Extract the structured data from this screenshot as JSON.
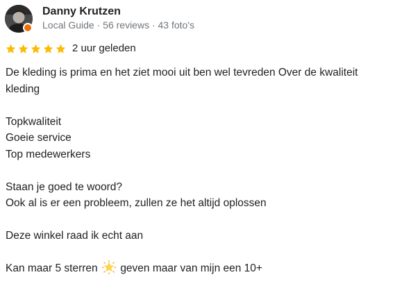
{
  "reviewer": {
    "name": "Danny Krutzen",
    "meta": "Local Guide · 56 reviews · 43 foto's",
    "avatar_icon": "profile-photo",
    "badge_icon": "local-guide-badge",
    "badge_color": "#e8710a"
  },
  "rating": {
    "stars": 5,
    "max": 5,
    "star_color": "#fbbc04",
    "date": "2 uur geleden"
  },
  "review": {
    "p1_line1": "De kleding is prima en het ziet mooi uit ben wel tevreden Over de kwaliteit",
    "p1_line2": "kleding",
    "p2_line1": "Topkwaliteit",
    "p2_line2": "Goeie service",
    "p2_line3": "Top medewerkers",
    "p3_line1": "Staan je goed te woord?",
    "p3_line2": "Ook al is er een probleem, zullen ze het altijd oplossen",
    "p4_line1": "Deze winkel raad ik echt aan",
    "p5_before": "Kan maar 5 sterren",
    "p5_emoji": "glowing-star-icon",
    "p5_after": "geven maar van mijn een 10+"
  }
}
